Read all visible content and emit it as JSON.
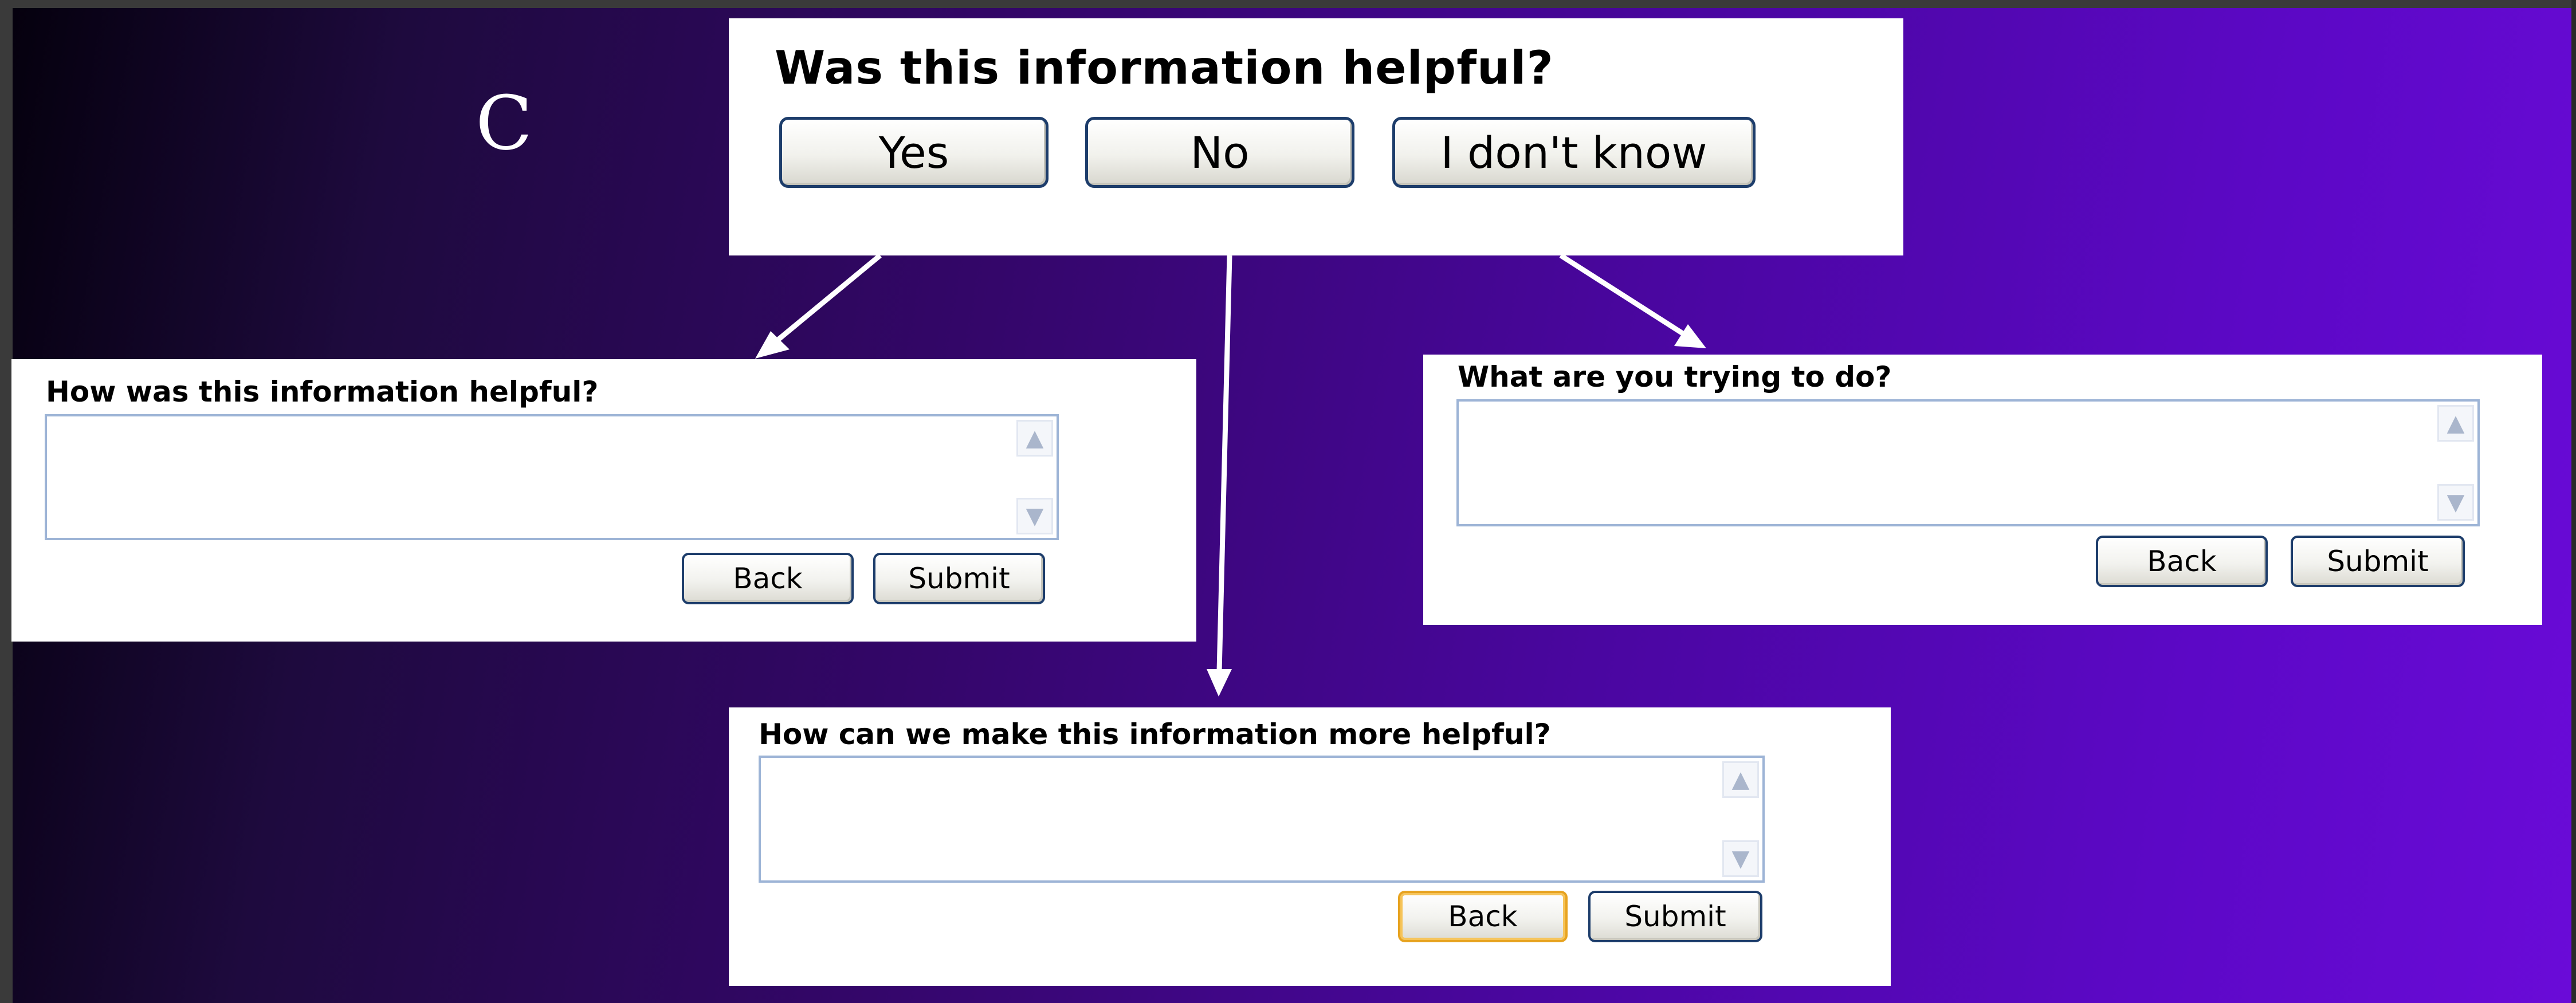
{
  "slide": {
    "letter": "C"
  },
  "feedback": {
    "question": "Was this information helpful?",
    "yes_label": "Yes",
    "no_label": "No",
    "idk_label": "I don't know"
  },
  "yes_form": {
    "prompt": "How was this information helpful?",
    "back_label": "Back",
    "submit_label": "Submit"
  },
  "idk_form": {
    "prompt": "What are you trying to do?",
    "back_label": "Back",
    "submit_label": "Submit"
  },
  "no_form": {
    "prompt": "How can we make this information more helpful?",
    "back_label": "Back",
    "submit_label": "Submit"
  },
  "icons": [
    "scroll-up-arrow-icon",
    "scroll-down-arrow-icon",
    "flow-arrow-icon"
  ],
  "colors": {
    "background_start": "#04000c",
    "background_end": "#6a0bd8",
    "button_border": "#1d3d6b",
    "focus_border": "#e7a320",
    "textbox_border": "#9db4d6"
  }
}
